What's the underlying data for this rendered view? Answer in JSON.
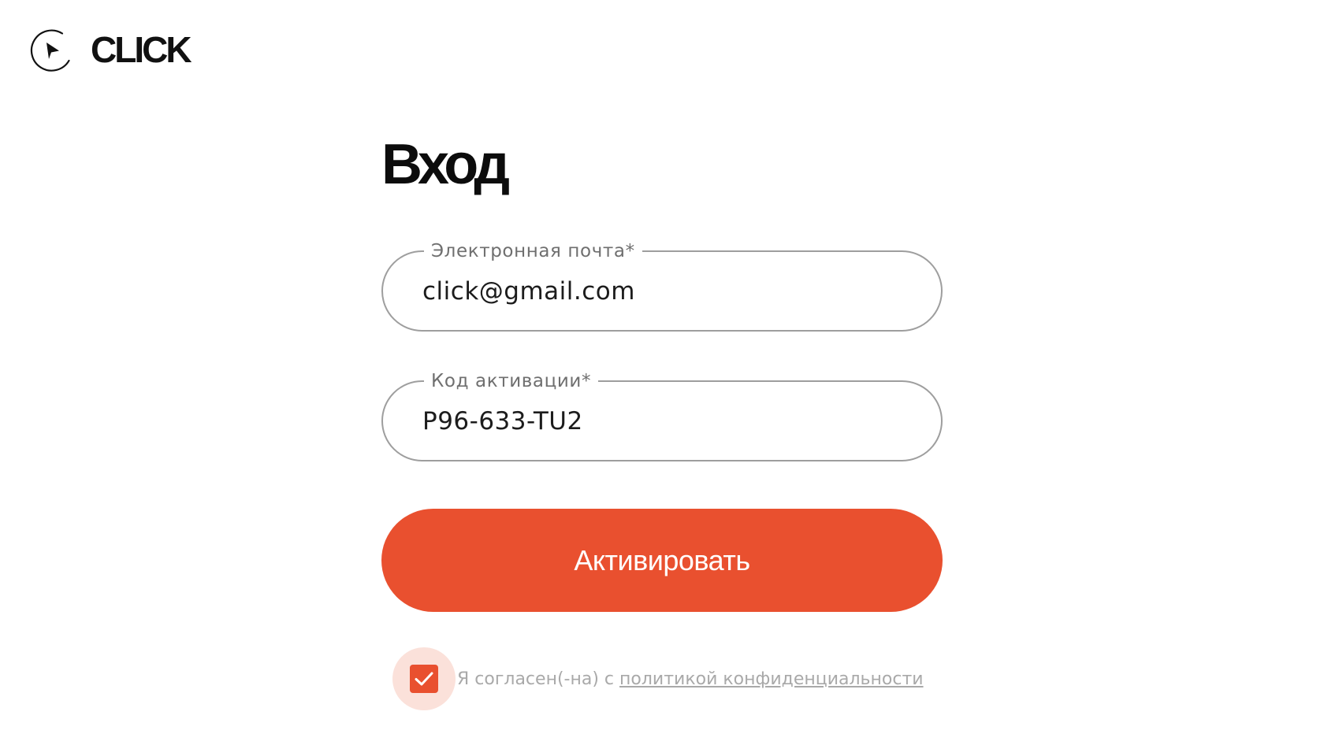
{
  "brand": {
    "name": "CLICK",
    "logo_icon": "play-circle-icon"
  },
  "login": {
    "title": "Вход",
    "email": {
      "label": "Электронная почта*",
      "value": "click@gmail.com"
    },
    "activation_code": {
      "label": "Код активации*",
      "value": "P96-633-TU2"
    },
    "submit_label": "Активировать",
    "consent": {
      "checked": true,
      "text": "Я согласен(-на) с ",
      "link_text": "политикой конфиденциальности"
    }
  },
  "colors": {
    "accent": "#e9502f",
    "checkbox_halo": "#fbe1da",
    "field_border": "#9e9e9e",
    "muted_text": "#a9a9a9"
  }
}
